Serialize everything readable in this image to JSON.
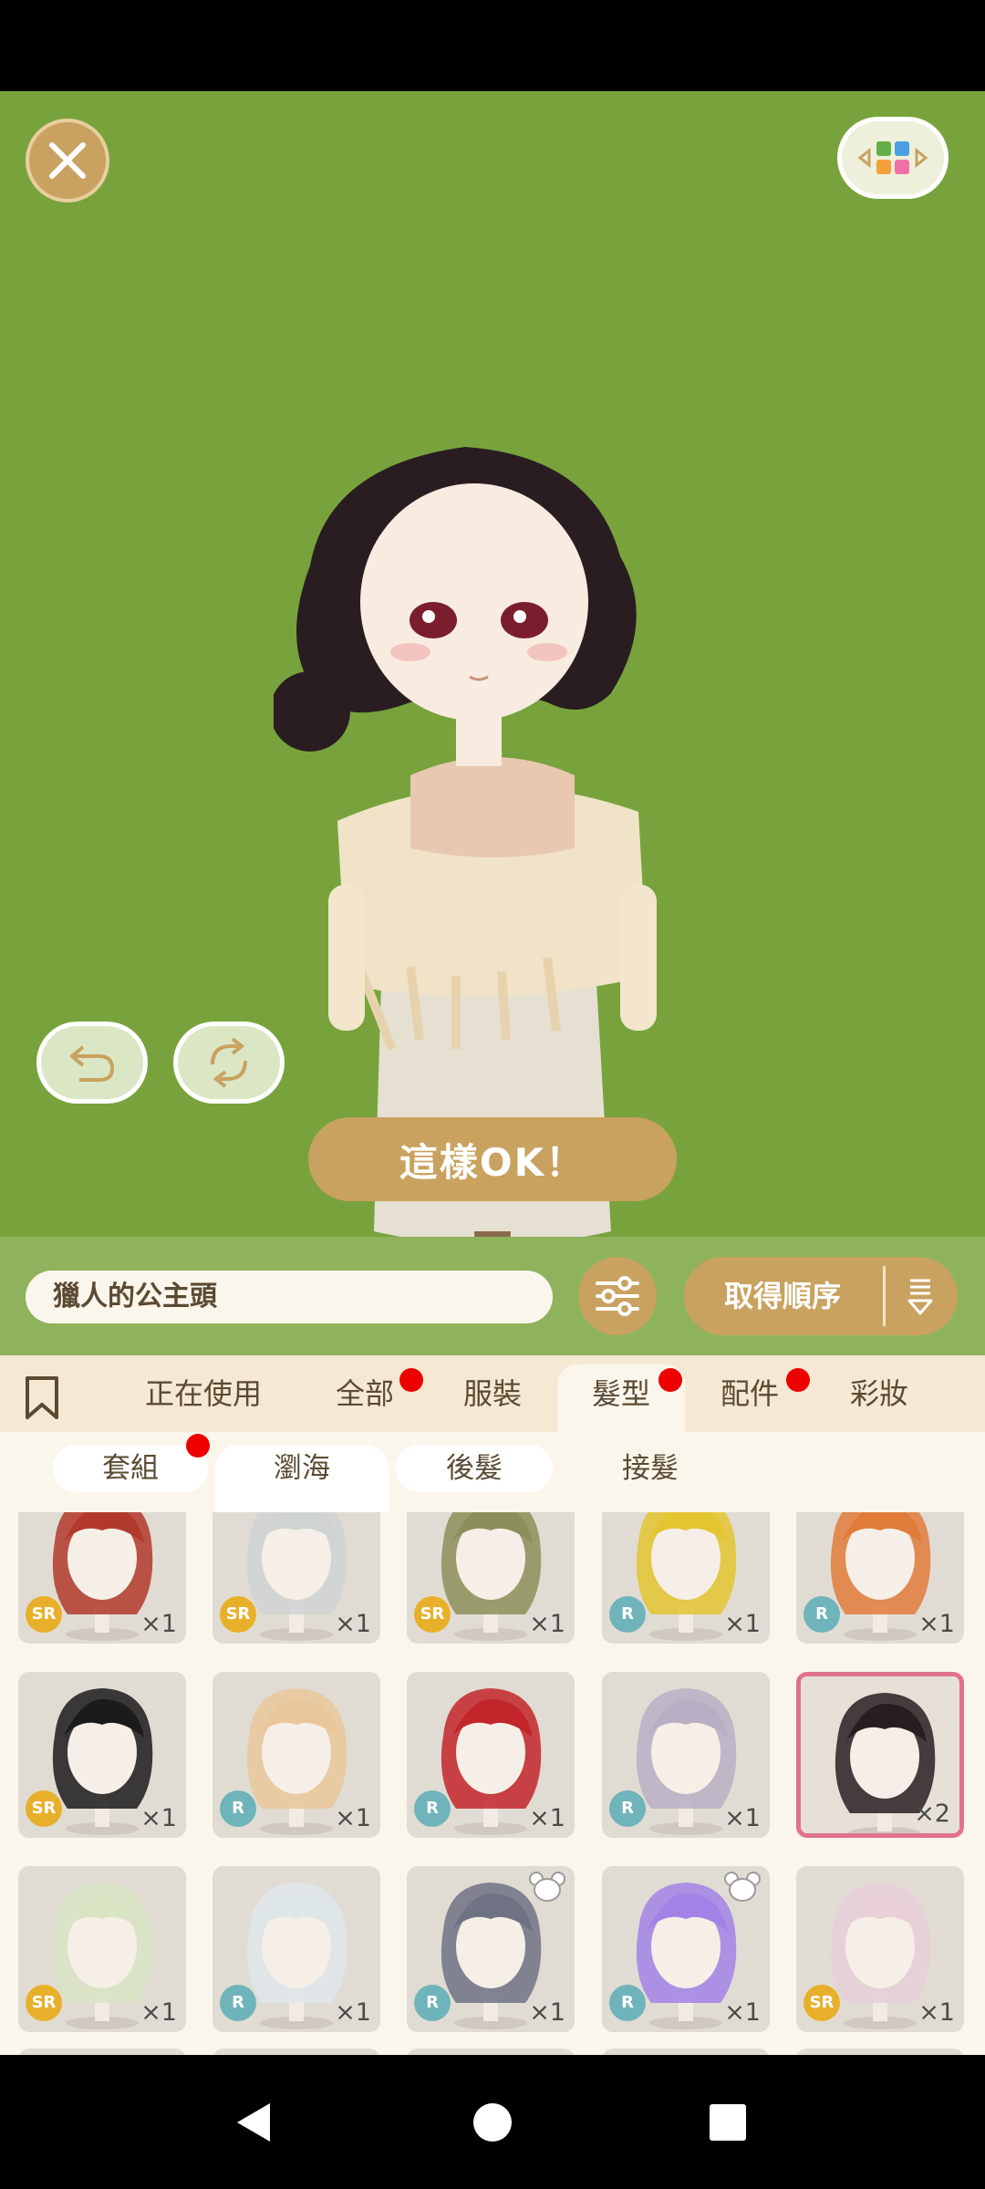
{
  "stage": {
    "ok_label": "這樣OK！",
    "background": "#78a33c"
  },
  "search": {
    "value": "獵人的公主頭",
    "sort_label": "取得順序"
  },
  "categories": [
    {
      "label": "正在使用",
      "dot": false,
      "active": false
    },
    {
      "label": "全部",
      "dot": true,
      "active": false
    },
    {
      "label": "服裝",
      "dot": false,
      "active": false
    },
    {
      "label": "髮型",
      "dot": true,
      "active": true
    },
    {
      "label": "配件",
      "dot": true,
      "active": false
    },
    {
      "label": "彩妝",
      "dot": false,
      "active": false
    }
  ],
  "subtabs": [
    {
      "label": "套組",
      "dot": true,
      "selected": false
    },
    {
      "label": "瀏海",
      "dot": false,
      "selected": true
    },
    {
      "label": "後髮",
      "dot": false,
      "selected": false
    },
    {
      "label": "接髮",
      "dot": false,
      "selected": false
    }
  ],
  "items": [
    {
      "rarity": "SR",
      "count": "×1",
      "hair_color": "#b23a2c",
      "bear": false,
      "selected": false
    },
    {
      "rarity": "SR",
      "count": "×1",
      "hair_color": "#cfd4d2",
      "bear": false,
      "selected": false
    },
    {
      "rarity": "SR",
      "count": "×1",
      "hair_color": "#8c8f5a",
      "bear": false,
      "selected": false
    },
    {
      "rarity": "R",
      "count": "×1",
      "hair_color": "#e3c431",
      "bear": false,
      "selected": false
    },
    {
      "rarity": "R",
      "count": "×1",
      "hair_color": "#e07b3a",
      "bear": false,
      "selected": false
    },
    {
      "rarity": "SR",
      "count": "×1",
      "hair_color": "#1b1b1b",
      "bear": false,
      "selected": false
    },
    {
      "rarity": "R",
      "count": "×1",
      "hair_color": "#e9c79a",
      "bear": false,
      "selected": false
    },
    {
      "rarity": "R",
      "count": "×1",
      "hair_color": "#c2262a",
      "bear": false,
      "selected": false
    },
    {
      "rarity": "R",
      "count": "×1",
      "hair_color": "#b8afc4",
      "bear": false,
      "selected": false
    },
    {
      "rarity": "",
      "count": "×2",
      "hair_color": "#2a1d22",
      "bear": false,
      "selected": true
    },
    {
      "rarity": "SR",
      "count": "×1",
      "hair_color": "#d9e4c4",
      "bear": false,
      "selected": false
    },
    {
      "rarity": "R",
      "count": "×1",
      "hair_color": "#dfe6ea",
      "bear": false,
      "selected": false
    },
    {
      "rarity": "R",
      "count": "×1",
      "hair_color": "#6e7283",
      "bear": true,
      "selected": false
    },
    {
      "rarity": "R",
      "count": "×1",
      "hair_color": "#a282e6",
      "bear": true,
      "selected": false
    },
    {
      "rarity": "SR",
      "count": "×1",
      "hair_color": "#e8cfd8",
      "bear": false,
      "selected": false
    }
  ]
}
